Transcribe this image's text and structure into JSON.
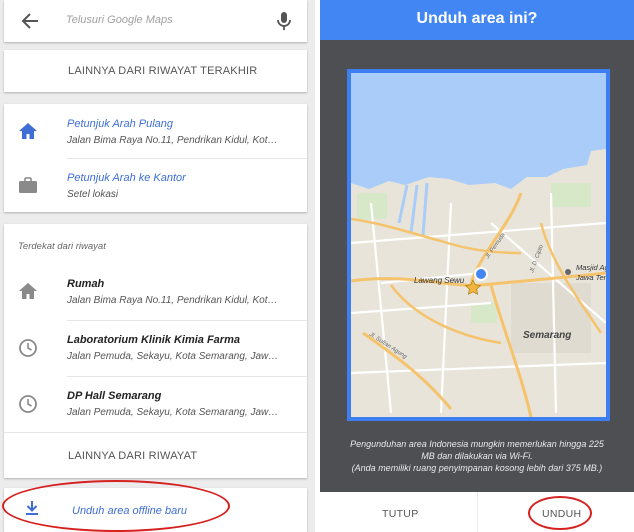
{
  "left": {
    "search_placeholder": "Telusuri Google Maps",
    "more_recent_label": "LAINNYA DARI RIWAYAT TERAKHIR",
    "shortcuts": [
      {
        "title": "Petunjuk Arah Pulang",
        "subtitle": "Jalan Bima Raya No.11, Pendrikan Kidul, Kota...",
        "icon": "home-icon"
      },
      {
        "title": "Petunjuk Arah ke Kantor",
        "subtitle": "Setel lokasi",
        "icon": "briefcase-icon"
      }
    ],
    "nearby_header": "Terdekat dari riwayat",
    "history": [
      {
        "title": "Rumah",
        "subtitle": "Jalan Bima Raya No.11, Pendrikan Kidul, Kota...",
        "icon": "home-icon"
      },
      {
        "title": "Laboratorium Klinik Kimia Farma",
        "subtitle": "Jalan Pemuda, Sekayu, Kota Semarang, Jawa...",
        "icon": "clock-icon"
      },
      {
        "title": "DP Hall Semarang",
        "subtitle": "Jalan Pemuda, Sekayu, Kota Semarang, Jawa...",
        "icon": "clock-icon"
      }
    ],
    "more_history_label": "LAINNYA DARI RIWAYAT",
    "offline_label": "Unduh area offline baru"
  },
  "right": {
    "title": "Unduh area ini?",
    "map_labels": {
      "lawang": "Lawang Sewu",
      "semarang": "Semarang",
      "masjid1": "Masjid Agung",
      "masjid2": "Jawa Tengah",
      "street1": "Jl. Pemuda",
      "street2": "Jl. D. Cipto",
      "street3": "Jl. Sultan Agung"
    },
    "note_lines": [
      "Pengunduhan area Indonesia mungkin memerlukan hingga 225",
      "MB dan dilakukan via Wi-Fi.",
      "(Anda memiliki ruang penyimpanan kosong lebih dari 375 MB.)"
    ],
    "cancel_label": "TUTUP",
    "download_label": "UNDUH"
  },
  "colors": {
    "accent": "#4286f4",
    "link": "#3e6ed6",
    "annotation": "#d62121",
    "water": "#a9ccf8",
    "land": "#e8e4da",
    "road": "#f5c36b"
  }
}
